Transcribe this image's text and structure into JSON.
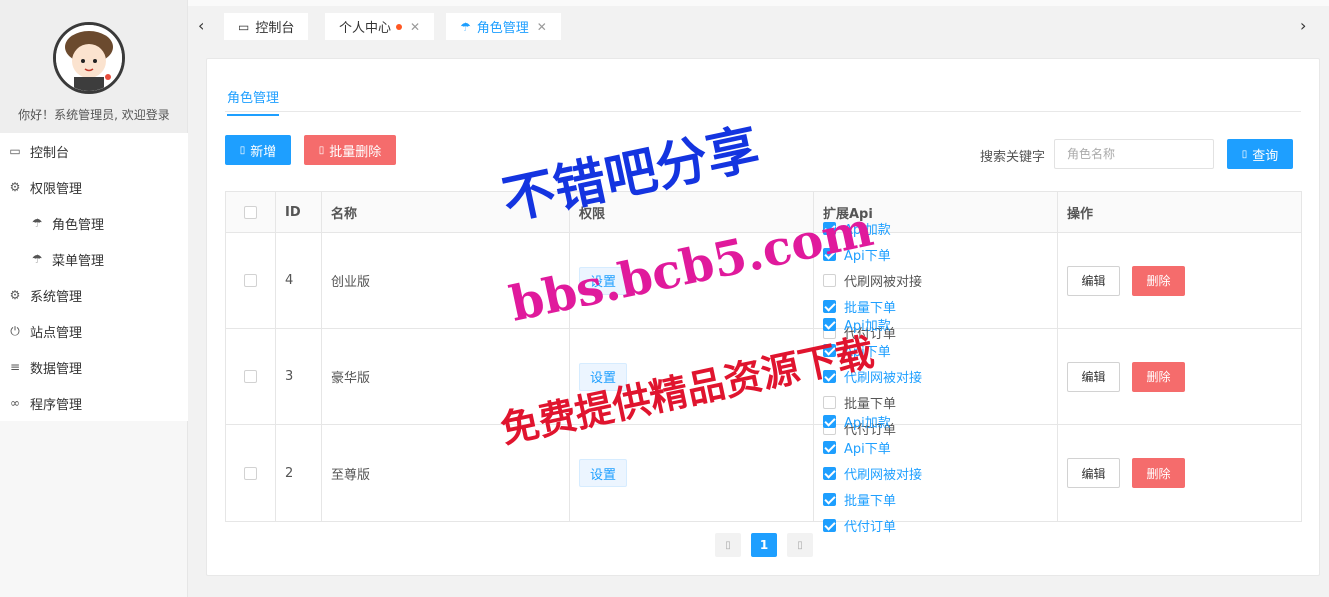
{
  "sidebar": {
    "greeting": "你好！系统管理员, 欢迎登录",
    "items": [
      {
        "label": "控制台",
        "icon": "monitor-icon"
      },
      {
        "label": "权限管理",
        "icon": "gear-icon"
      },
      {
        "label": "角色管理",
        "icon": "umbrella-icon"
      },
      {
        "label": "菜单管理",
        "icon": "umbrella-icon"
      },
      {
        "label": "系统管理",
        "icon": "gear-icon"
      },
      {
        "label": "站点管理",
        "icon": "power-icon"
      },
      {
        "label": "数据管理",
        "icon": "list-icon"
      },
      {
        "label": "程序管理",
        "icon": "infinity-icon"
      }
    ]
  },
  "tabs": [
    {
      "label": "控制台",
      "icon": "monitor-icon"
    },
    {
      "label": "个人中心",
      "close": "✕"
    },
    {
      "label": "角色管理",
      "icon": "umbrella-icon",
      "close": "✕"
    }
  ],
  "card": {
    "title": "角色管理",
    "add_label": "新增",
    "batch_delete_label": "批量删除",
    "search_label": "搜索关键字",
    "search_placeholder": "角色名称",
    "search_button": "查询"
  },
  "table": {
    "headers": [
      "ID",
      "名称",
      "权限",
      "扩展Api",
      "操作"
    ],
    "perm_button": "设置",
    "edit_label": "编辑",
    "delete_label": "删除",
    "rows": [
      {
        "id": "4",
        "name": "创业版",
        "apis": [
          {
            "label": "Api加款",
            "checked": true
          },
          {
            "label": "Api下单",
            "checked": true
          },
          {
            "label": "代刷网被对接",
            "checked": false
          },
          {
            "label": "批量下单",
            "checked": true
          },
          {
            "label": "代付订单",
            "checked": false
          }
        ]
      },
      {
        "id": "3",
        "name": "豪华版",
        "apis": [
          {
            "label": "Api加款",
            "checked": true
          },
          {
            "label": "Api下单",
            "checked": true
          },
          {
            "label": "代刷网被对接",
            "checked": true
          },
          {
            "label": "批量下单",
            "checked": false
          },
          {
            "label": "代付订单",
            "checked": false
          }
        ]
      },
      {
        "id": "2",
        "name": "至尊版",
        "apis": [
          {
            "label": "Api加款",
            "checked": true
          },
          {
            "label": "Api下单",
            "checked": true
          },
          {
            "label": "代刷网被对接",
            "checked": true
          },
          {
            "label": "批量下单",
            "checked": true
          },
          {
            "label": "代付订单",
            "checked": true
          }
        ]
      }
    ]
  },
  "pagination": {
    "current": "1"
  },
  "watermark": {
    "line1": "不错吧分享",
    "line2": "bbs.bcb5.com",
    "line3": "免费提供精品资源下载"
  },
  "colors": {
    "accent": "#1e9fff",
    "danger": "#f56c6c",
    "badge_dot": "#ff5722"
  }
}
